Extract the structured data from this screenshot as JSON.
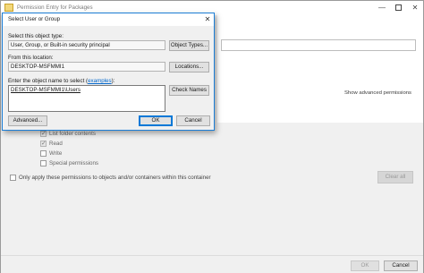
{
  "parent_window": {
    "title": "Permission Entry for Packages",
    "caption": {
      "minimize": "—",
      "close": "✕"
    },
    "show_advanced_link": "Show advanced permissions",
    "permissions": [
      {
        "label": "List folder contents",
        "checked": true
      },
      {
        "label": "Read",
        "checked": true
      },
      {
        "label": "Write",
        "checked": false
      },
      {
        "label": "Special permissions",
        "checked": false
      }
    ],
    "clear_all_label": "Clear all",
    "only_apply_label": "Only apply these permissions to objects and/or containers within this container",
    "ok_label": "OK",
    "cancel_label": "Cancel"
  },
  "dialog": {
    "title": "Select User or Group",
    "close_glyph": "✕",
    "object_type_label": "Select this object type:",
    "object_type_value": "User, Group, or Built-in security principal",
    "object_types_button": "Object Types...",
    "location_label": "From this location:",
    "location_value": "DESKTOP-MSFMMI1",
    "locations_button": "Locations...",
    "enter_label_prefix": "Enter the object name to select (",
    "examples_link": "examples",
    "enter_label_suffix": "):",
    "object_name_value": "DESKTOP-MSFMMI1\\Users",
    "check_names_button": "Check Names",
    "advanced_button": "Advanced...",
    "ok_button": "OK",
    "cancel_button": "Cancel"
  },
  "colors": {
    "accent": "#0078d7",
    "dialog_border": "#1c7ed6",
    "window_bg": "#f0f0f0",
    "link": "#0066cc"
  }
}
